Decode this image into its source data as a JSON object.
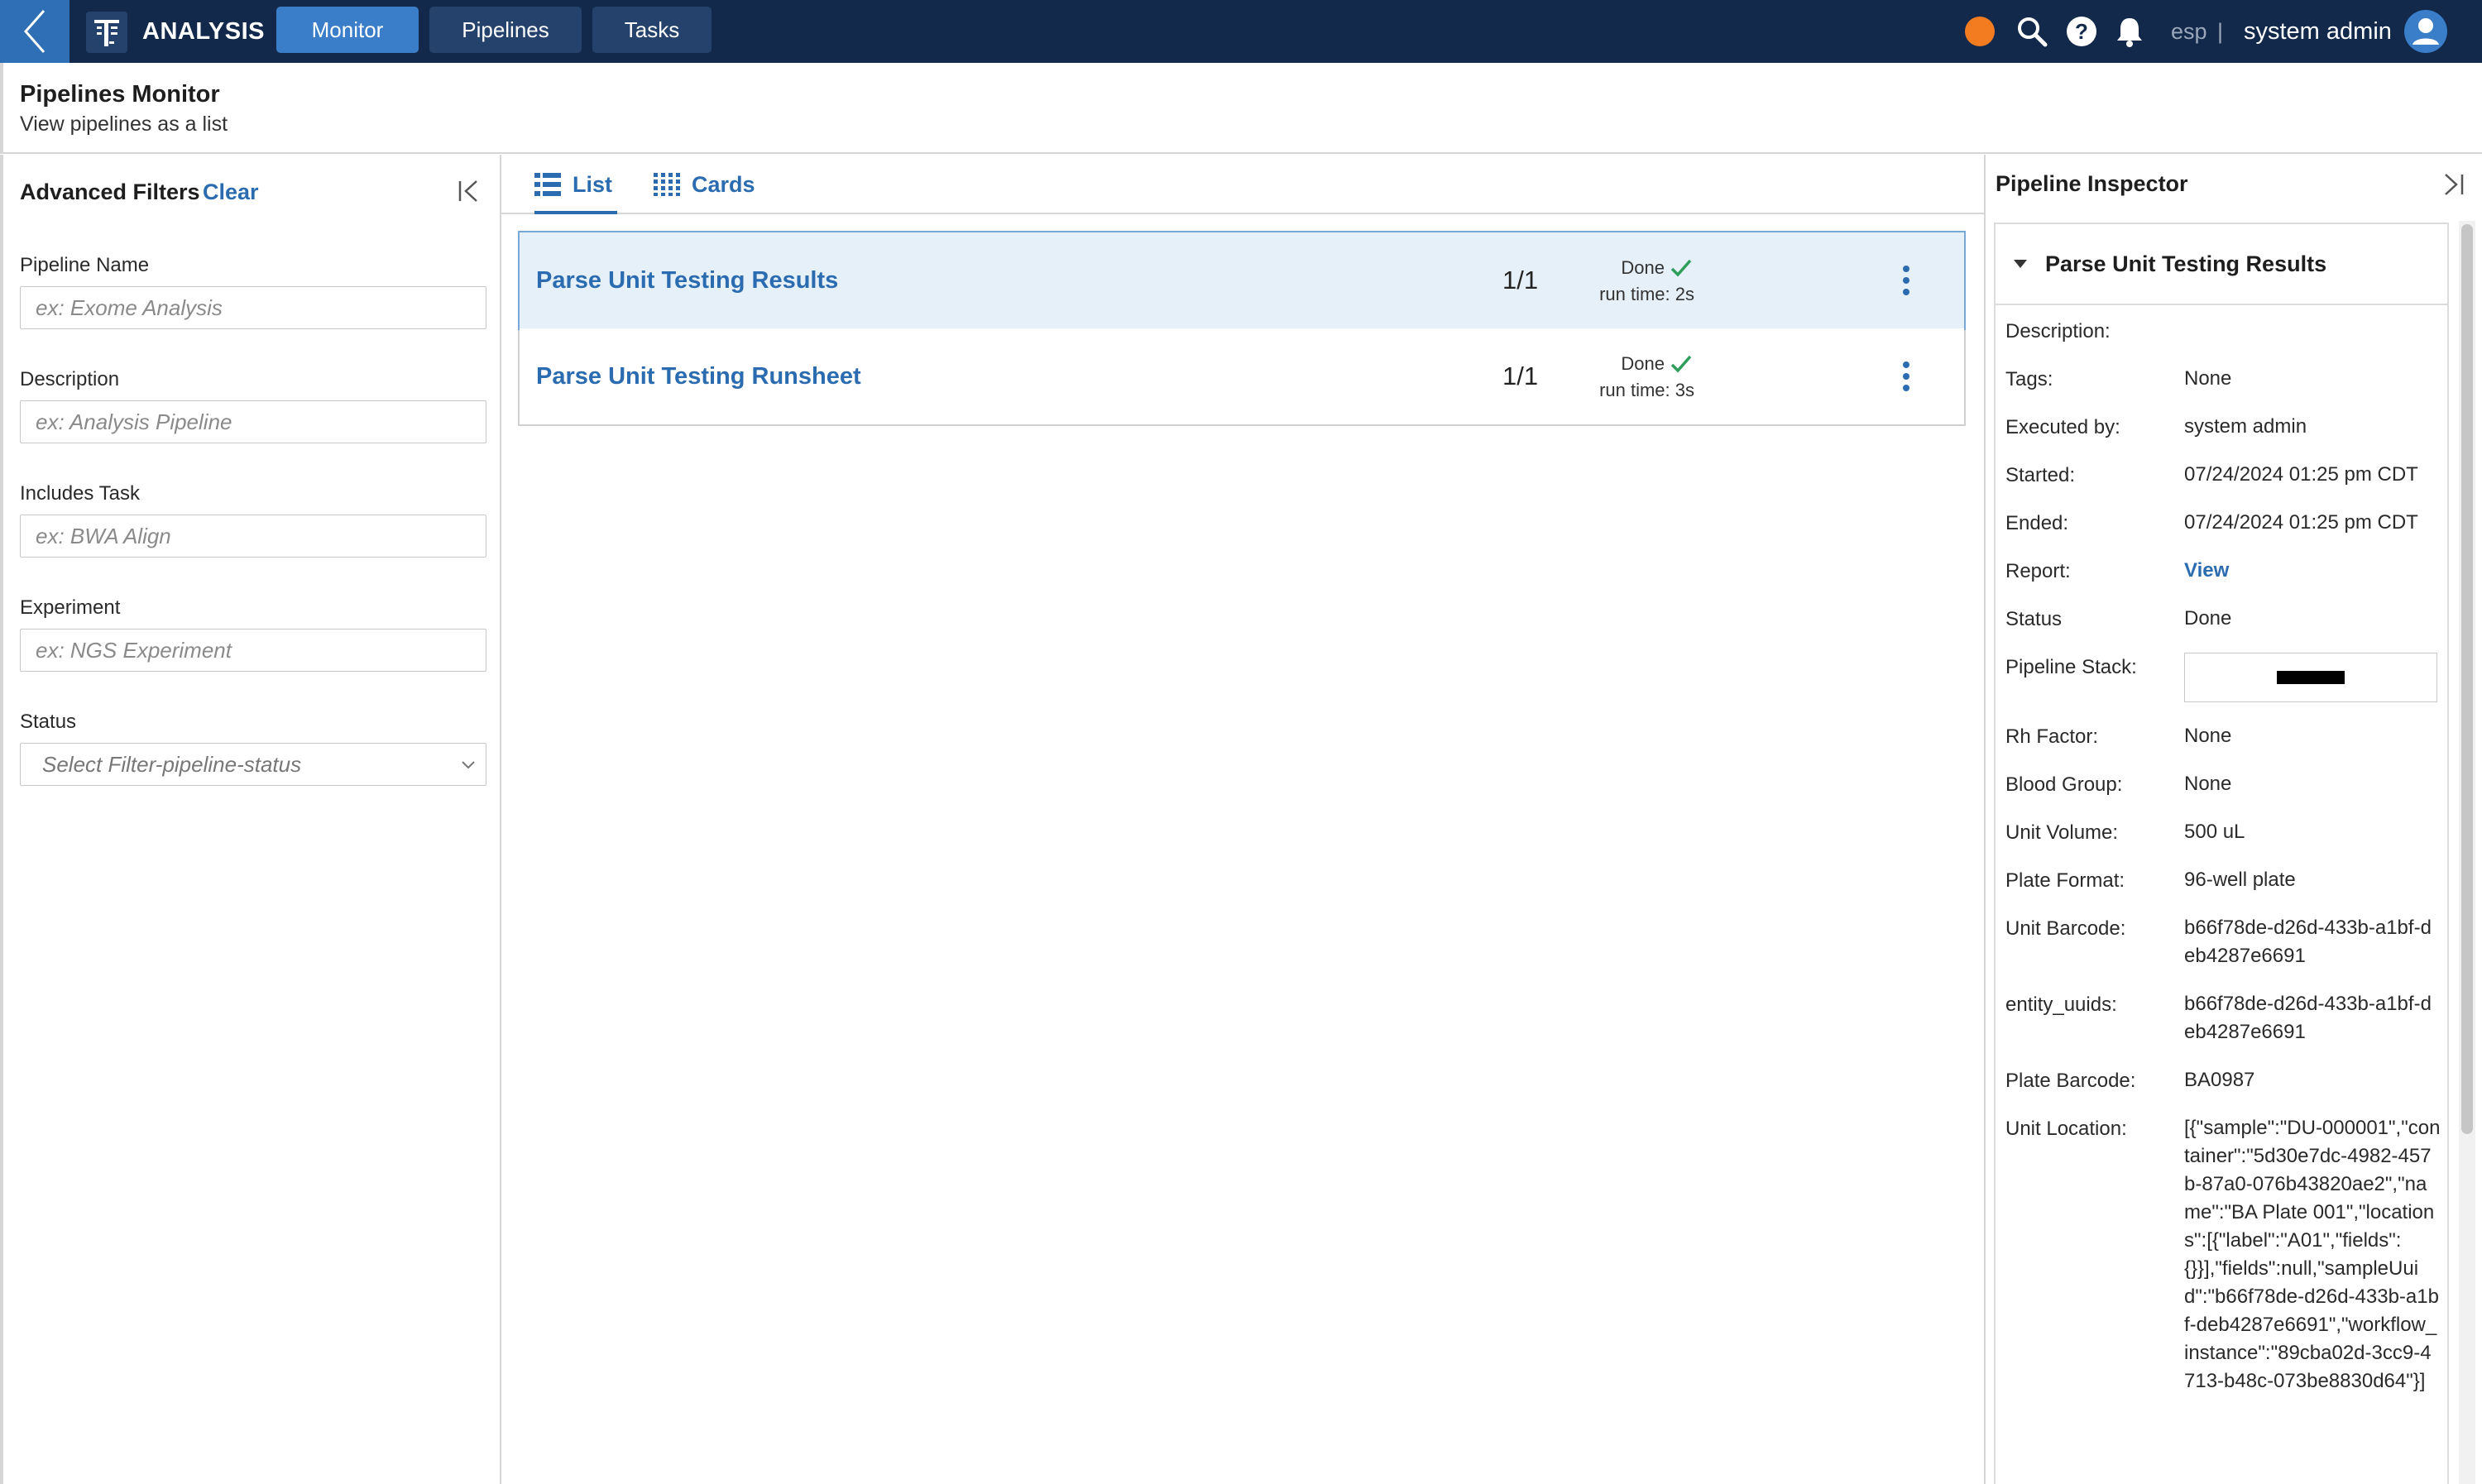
{
  "topbar": {
    "app_name": "ANALYSIS",
    "tabs": [
      {
        "label": "Monitor",
        "active": true
      },
      {
        "label": "Pipelines",
        "active": false
      },
      {
        "label": "Tasks",
        "active": false
      }
    ],
    "env": "esp",
    "env_separator": "|",
    "user": "system admin",
    "status_color": "#f47c20"
  },
  "header": {
    "title": "Pipelines Monitor",
    "subtitle": "View pipelines as a list"
  },
  "filters": {
    "title": "Advanced Filters",
    "clear": "Clear",
    "pipeline_name": {
      "label": "Pipeline Name",
      "placeholder": "ex: Exome Analysis"
    },
    "description": {
      "label": "Description",
      "placeholder": "ex: Analysis Pipeline"
    },
    "includes_task": {
      "label": "Includes Task",
      "placeholder": "ex: BWA Align"
    },
    "experiment": {
      "label": "Experiment",
      "placeholder": "ex: NGS Experiment"
    },
    "status": {
      "label": "Status",
      "placeholder": "Select Filter-pipeline-status"
    }
  },
  "view": {
    "tabs": [
      {
        "label": "List",
        "icon": "list-icon",
        "active": true
      },
      {
        "label": "Cards",
        "icon": "grid-icon",
        "active": false
      }
    ]
  },
  "pipelines": [
    {
      "name": "Parse Unit Testing Results",
      "status": "Done",
      "runtime": "run time: 2s",
      "count": "1/1",
      "selected": true
    },
    {
      "name": "Parse Unit Testing Runsheet",
      "status": "Done",
      "runtime": "run time: 3s",
      "count": "1/1",
      "selected": false
    }
  ],
  "inspector": {
    "title": "Pipeline Inspector",
    "panel_title": "Parse Unit Testing Results",
    "fields": {
      "description": {
        "key": "Description:",
        "value": ""
      },
      "tags": {
        "key": "Tags:",
        "value": "None"
      },
      "executed_by": {
        "key": "Executed by:",
        "value": "system admin"
      },
      "started": {
        "key": "Started:",
        "value": "07/24/2024 01:25 pm CDT"
      },
      "ended": {
        "key": "Ended:",
        "value": "07/24/2024 01:25 pm CDT"
      },
      "report": {
        "key": "Report:",
        "value": "View"
      },
      "status": {
        "key": "Status",
        "value": "Done"
      },
      "pipeline_stack": {
        "key": "Pipeline Stack:"
      },
      "rh_factor": {
        "key": "Rh Factor:",
        "value": "None"
      },
      "blood_group": {
        "key": "Blood Group:",
        "value": "None"
      },
      "unit_volume": {
        "key": "Unit Volume:",
        "value": "500 uL"
      },
      "plate_format": {
        "key": "Plate Format:",
        "value": "96-well plate"
      },
      "unit_barcode": {
        "key": "Unit Barcode:",
        "value": "b66f78de-d26d-433b-a1bf-deb4287e6691"
      },
      "entity_uuids": {
        "key": "entity_uuids:",
        "value": "b66f78de-d26d-433b-a1bf-deb4287e6691"
      },
      "plate_barcode": {
        "key": "Plate Barcode:",
        "value": "BA0987"
      },
      "unit_location": {
        "key": "Unit Location:",
        "value": "[{\"sample\":\"DU-000001\",\"container\":\"5d30e7dc-4982-457b-87a0-076b43820ae2\",\"name\":\"BA Plate 001\",\"locations\":[{\"label\":\"A01\",\"fields\":{}}],\"fields\":null,\"sampleUuid\":\"b66f78de-d26d-433b-a1bf-deb4287e6691\",\"workflow_instance\":\"89cba02d-3cc9-4713-b48c-073be8830d64\"}]"
      }
    }
  },
  "colors": {
    "topbar_bg": "#13294b",
    "accent": "#2b6cb0",
    "active_tab": "#3a7dc9",
    "success": "#2e9e5a",
    "selected_row": "#e6f0f9"
  }
}
